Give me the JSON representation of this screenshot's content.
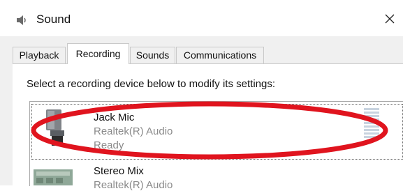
{
  "window": {
    "title": "Sound",
    "icon": "speaker-icon",
    "close_icon": "close-icon"
  },
  "tabs": [
    {
      "label": "Playback",
      "active": false
    },
    {
      "label": "Recording",
      "active": true
    },
    {
      "label": "Sounds",
      "active": false
    },
    {
      "label": "Communications",
      "active": false
    }
  ],
  "instruction": "Select a recording device below to modify its settings:",
  "devices": [
    {
      "name": "Jack Mic",
      "driver": "Realtek(R) Audio",
      "status": "Ready",
      "icon": "microphone-icon",
      "selected": true
    },
    {
      "name": "Stereo Mix",
      "driver": "Realtek(R) Audio",
      "icon": "sound-card-icon",
      "selected": false
    }
  ],
  "annotation": {
    "color": "#e0141e",
    "shape": "ellipse"
  }
}
